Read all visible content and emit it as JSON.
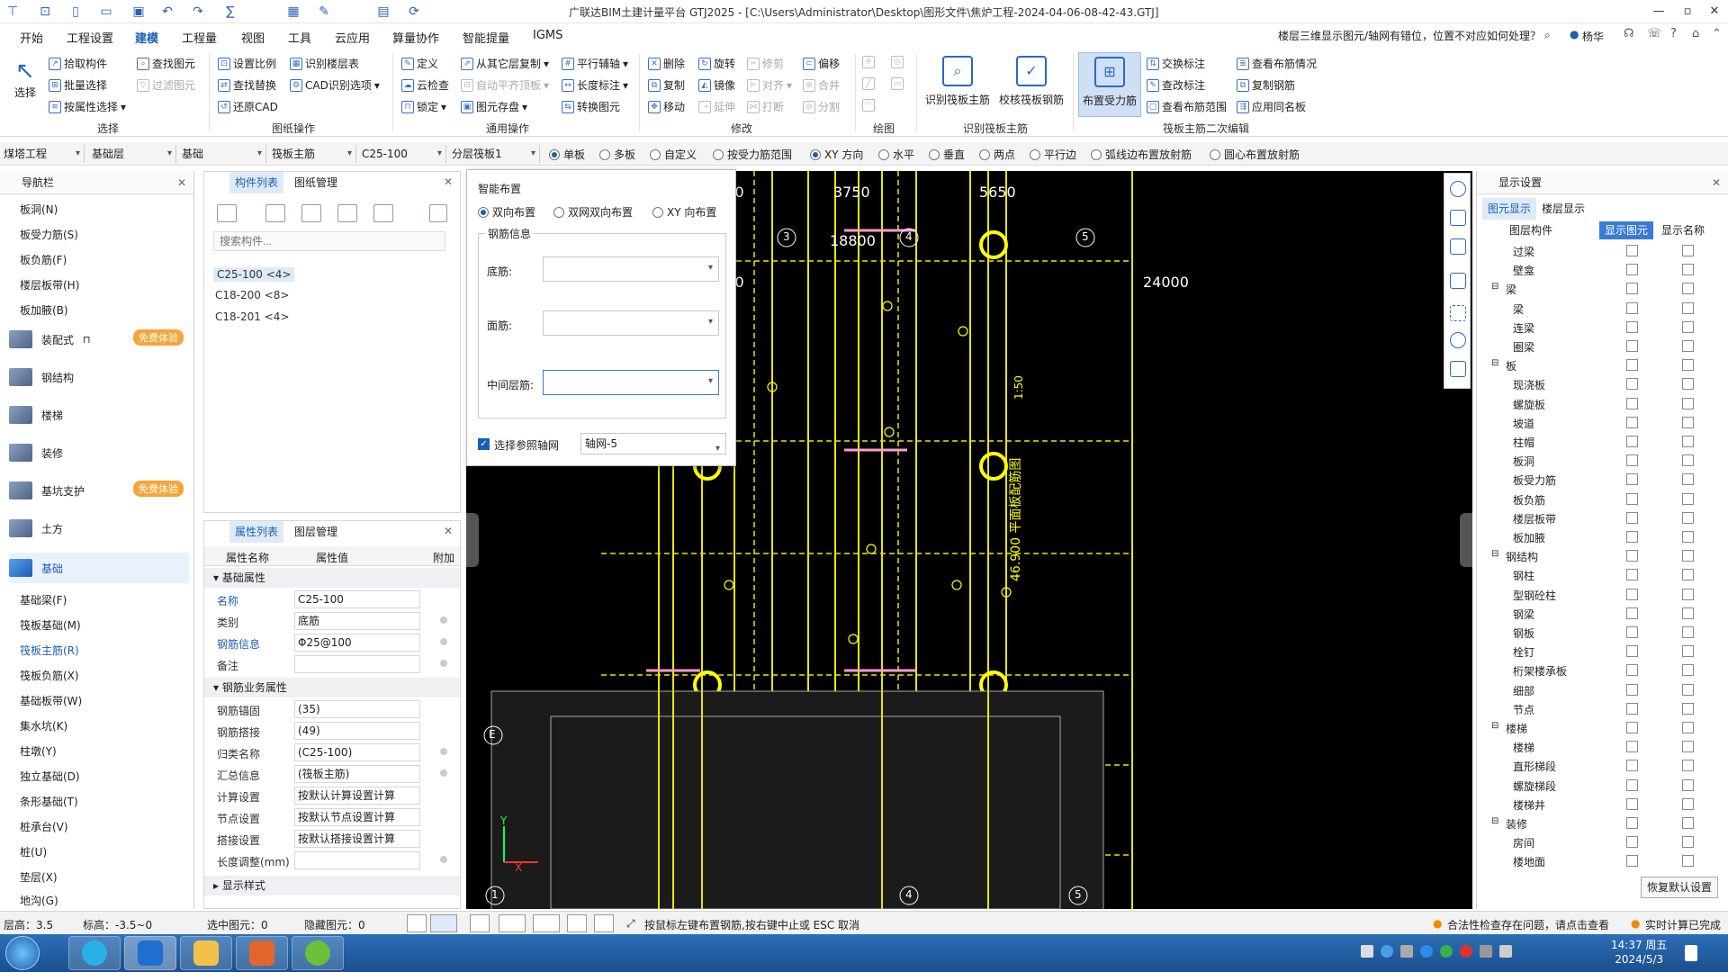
{
  "app": {
    "title": "广联达BIM土建计量平台 GTJ2025 - [C:\\Users\\Administrator\\Desktop\\图形文件\\焦炉工程-2024-04-06-08-42-43.GTJ]",
    "window_controls": [
      "—",
      "▫",
      "✕"
    ]
  },
  "menu": {
    "items": [
      "开始",
      "工程设置",
      "建模",
      "工程量",
      "视图",
      "工具",
      "云应用",
      "算量协作",
      "智能提量",
      "IGMS"
    ],
    "active": "建模",
    "notice": "楼层三维显示图元/轴网有错位，位置不对应如何处理？",
    "user": "杨华"
  },
  "ribbon": {
    "select_group": {
      "big": "选择",
      "pick": "拾取构件",
      "batch": "批量选择",
      "by_attr": "按属性选择",
      "find": "查找图元",
      "filter": "过滤图元",
      "label": "选择"
    },
    "drawing_group": {
      "set_scale": "设置比例",
      "find_replace": "查找替换",
      "restore_cad": "还原CAD",
      "recog_floor": "识别楼层表",
      "cad_recog": "CAD识别选项",
      "label": "图纸操作"
    },
    "common_group": {
      "define": "定义",
      "cloud_check": "云检查",
      "lock": "锁定",
      "copy_from": "从其它层复制",
      "auto_slab": "自动平齐顶板",
      "elem_save": "图元存盘",
      "parallel": "平行辅轴",
      "length_mark": "长度标注",
      "convert": "转换图元",
      "label": "通用操作"
    },
    "modify_group": {
      "delete": "删除",
      "rotate": "旋转",
      "trim": "修剪",
      "offset": "偏移",
      "copy": "复制",
      "mirror": "镜像",
      "align": "对齐",
      "merge": "合并",
      "move": "移动",
      "extend": "延伸",
      "break": "打断",
      "split": "分割",
      "label": "修改"
    },
    "draw_label": "绘图",
    "recog_group": {
      "recog_main": "识别筏板主筋",
      "check_main": "校核筏板钢筋",
      "label": "识别筏板主筋"
    },
    "secondary_group": {
      "layout": "布置受力筋",
      "swap": "交换标注",
      "check_mark": "查改标注",
      "view_range": "查看布筋范围",
      "view_info": "查看布筋情况",
      "copy_rebar": "复制钢筋",
      "apply_same": "应用同名板",
      "label": "筏板主筋二次编辑"
    }
  },
  "propbar": {
    "combos": [
      "煤塔工程",
      "基础层",
      "基础",
      "筏板主筋",
      "C25-100",
      "分层筏板1"
    ],
    "radios": [
      "单板",
      "多板",
      "自定义",
      "按受力筋范围",
      "XY 方向",
      "水平",
      "垂直",
      "两点",
      "平行边",
      "弧线边布置放射筋",
      "圆心布置放射筋"
    ],
    "checked": [
      "单板",
      "XY 方向"
    ]
  },
  "nav": {
    "title": "导航栏",
    "top_items": [
      "板洞(N)",
      "板受力筋(S)",
      "板负筋(F)",
      "楼层板带(H)",
      "板加腋(B)"
    ],
    "groups": [
      {
        "label": "装配式",
        "badge": "免费体验"
      },
      {
        "label": "钢结构",
        "badge": ""
      },
      {
        "label": "楼梯",
        "badge": ""
      },
      {
        "label": "装修",
        "badge": ""
      },
      {
        "label": "基坑支护",
        "badge": "免费体验"
      },
      {
        "label": "土方",
        "badge": ""
      },
      {
        "label": "基础",
        "badge": ""
      }
    ],
    "sub_items": [
      "基础梁(F)",
      "筏板基础(M)",
      "筏板主筋(R)",
      "筏板负筋(X)",
      "基础板带(W)",
      "集水坑(K)",
      "柱墩(Y)",
      "独立基础(D)",
      "条形基础(T)",
      "桩承台(V)",
      "桩(U)",
      "垫层(X)",
      "地沟(G)"
    ],
    "selected": "筏板主筋(R)"
  },
  "complist": {
    "tabs": [
      "构件列表",
      "图纸管理"
    ],
    "search_placeholder": "搜索构件...",
    "items": [
      "C25-100 <4>",
      "C18-200 <8>",
      "C18-201 <4>"
    ]
  },
  "proplist": {
    "tabs": [
      "属性列表",
      "图层管理"
    ],
    "headers": [
      "属性名称",
      "属性值",
      "附加"
    ],
    "sections": [
      "基础属性",
      "钢筋业务属性",
      "显示样式"
    ],
    "rows1": [
      {
        "name": "名称",
        "value": "C25-100"
      },
      {
        "name": "类别",
        "value": "底筋"
      },
      {
        "name": "钢筋信息",
        "value": "Φ25@100"
      },
      {
        "name": "备注",
        "value": ""
      }
    ],
    "rows2": [
      {
        "name": "钢筋锚固",
        "value": "(35)"
      },
      {
        "name": "钢筋搭接",
        "value": "(49)"
      },
      {
        "name": "归类名称",
        "value": "(C25-100)"
      },
      {
        "name": "汇总信息",
        "value": "(筏板主筋)"
      },
      {
        "name": "计算设置",
        "value": "按默认计算设置计算"
      },
      {
        "name": "节点设置",
        "value": "按默认节点设置计算"
      },
      {
        "name": "搭接设置",
        "value": "按默认搭接设置计算"
      },
      {
        "name": "长度调整(mm)",
        "value": ""
      }
    ]
  },
  "dialog": {
    "title": "智能布置",
    "options": [
      "双向布置",
      "双网双向布置",
      "XY 向布置"
    ],
    "selected": "双向布置",
    "group_title": "钢筋信息",
    "fields": [
      "底筋:",
      "面筋:",
      "中间层筋:"
    ],
    "ref_axis_label": "选择参照轴网",
    "ref_axis_value": "轴网-5"
  },
  "canvas": {
    "dims": [
      "3750",
      "3750",
      "5650",
      "18800",
      "3750",
      "24000"
    ],
    "axes": [
      "3",
      "4",
      "5",
      "1",
      "4",
      "5",
      "E"
    ],
    "vertical_text": "46.900 平面板配筋图",
    "scale_text": "1:50"
  },
  "dispset": {
    "title": "显示设置",
    "tabs": [
      "图元显示",
      "楼层显示"
    ],
    "headers": [
      "图层构件",
      "显示图元",
      "显示名称"
    ],
    "rows": [
      {
        "name": "过梁",
        "level": 1
      },
      {
        "name": "壁龛",
        "level": 1
      },
      {
        "name": "梁",
        "level": 0
      },
      {
        "name": "梁",
        "level": 1
      },
      {
        "name": "连梁",
        "level": 1
      },
      {
        "name": "圈梁",
        "level": 1
      },
      {
        "name": "板",
        "level": 0
      },
      {
        "name": "现浇板",
        "level": 1
      },
      {
        "name": "螺旋板",
        "level": 1
      },
      {
        "name": "坡道",
        "level": 1
      },
      {
        "name": "柱帽",
        "level": 1
      },
      {
        "name": "板洞",
        "level": 1
      },
      {
        "name": "板受力筋",
        "level": 1
      },
      {
        "name": "板负筋",
        "level": 1
      },
      {
        "name": "楼层板带",
        "level": 1
      },
      {
        "name": "板加腋",
        "level": 1
      },
      {
        "name": "钢结构",
        "level": 0
      },
      {
        "name": "钢柱",
        "level": 1
      },
      {
        "name": "型钢砼柱",
        "level": 1
      },
      {
        "name": "钢梁",
        "level": 1
      },
      {
        "name": "钢板",
        "level": 1
      },
      {
        "name": "栓钉",
        "level": 1
      },
      {
        "name": "桁架楼承板",
        "level": 1
      },
      {
        "name": "细部",
        "level": 1
      },
      {
        "name": "节点",
        "level": 1
      },
      {
        "name": "楼梯",
        "level": 0
      },
      {
        "name": "楼梯",
        "level": 1
      },
      {
        "name": "直形梯段",
        "level": 1
      },
      {
        "name": "螺旋梯段",
        "level": 1
      },
      {
        "name": "楼梯井",
        "level": 1
      },
      {
        "name": "装修",
        "level": 0
      },
      {
        "name": "房间",
        "level": 1
      },
      {
        "name": "楼地面",
        "level": 1
      }
    ],
    "restore_button": "恢复默认设置"
  },
  "status": {
    "floor_height": "层高：3.5",
    "elevation": "标高：-3.5~0",
    "selected": "选中图元：0",
    "hidden": "隐藏图元：0",
    "hint": "按鼠标左键布置钢筋,按右键中止或 ESC 取消",
    "legal_check": "合法性检查存在问题，请点击查看",
    "realtime": "实时计算已完成"
  },
  "taskbar": {
    "time": "14:37 周五",
    "date": "2024/5/3"
  },
  "colors": {
    "accent": "#1a5fb4",
    "cad_yellow": "#ffff00",
    "cad_pink": "#ff9bd0",
    "badge": "#f6a53b"
  }
}
